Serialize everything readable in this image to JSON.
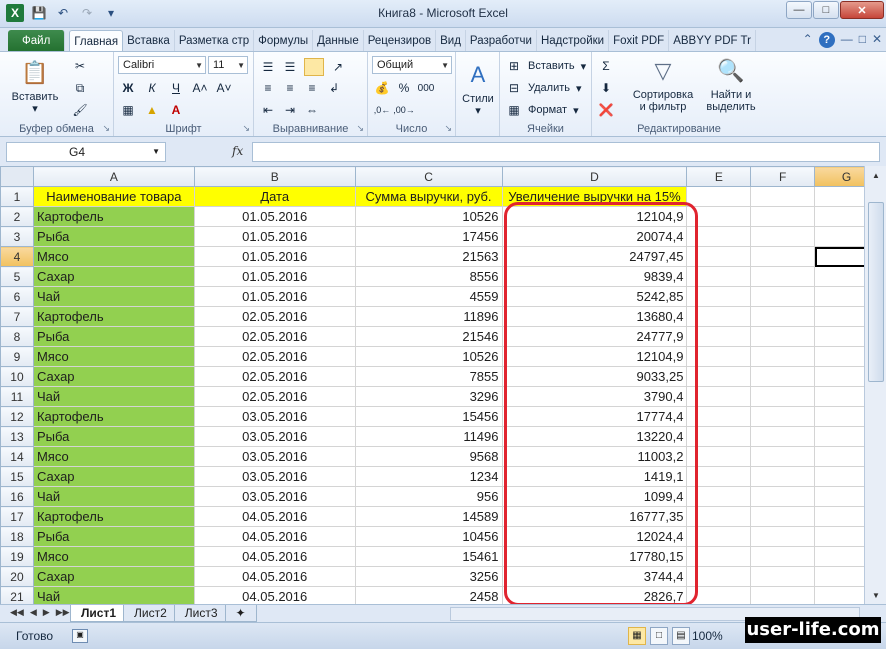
{
  "window": {
    "title": "Книга8 - Microsoft Excel"
  },
  "colors": {
    "header_yellow": "#ffff00",
    "name_green": "#92d050",
    "highlight_red": "#e0242f",
    "excel_green": "#1f7a3c"
  },
  "ribbon": {
    "tabs": [
      "Файл",
      "Главная",
      "Вставка",
      "Разметка стр",
      "Формулы",
      "Данные",
      "Рецензиров",
      "Вид",
      "Разработчи",
      "Надстройки",
      "Foxit PDF",
      "ABBYY PDF Tr"
    ],
    "paste_label": "Вставить",
    "font_name": "Calibri",
    "font_size": "11",
    "number_format": "Общий",
    "styles_label": "Стили",
    "insert_label": "Вставить",
    "delete_label": "Удалить",
    "format_label": "Формат",
    "sort_label_1": "Сортировка",
    "sort_label_2": "и фильтр",
    "find_label_1": "Найти и",
    "find_label_2": "выделить",
    "groups": {
      "clipboard": "Буфер обмена",
      "font": "Шрифт",
      "alignment": "Выравнивание",
      "number": "Число",
      "cells": "Ячейки",
      "editing": "Редактирование"
    }
  },
  "formula_bar": {
    "name_box": "G4",
    "fx_label": "fx",
    "formula": ""
  },
  "sheet": {
    "columns": [
      "A",
      "B",
      "C",
      "D",
      "E",
      "F",
      "G"
    ],
    "headers": [
      "Наименование товара",
      "Дата",
      "Сумма выручки, руб.",
      "Увеличение выручки на 15%"
    ],
    "rows": [
      [
        "Картофель",
        "01.05.2016",
        "10526",
        "12104,9"
      ],
      [
        "Рыба",
        "01.05.2016",
        "17456",
        "20074,4"
      ],
      [
        "Мясо",
        "01.05.2016",
        "21563",
        "24797,45"
      ],
      [
        "Сахар",
        "01.05.2016",
        "8556",
        "9839,4"
      ],
      [
        "Чай",
        "01.05.2016",
        "4559",
        "5242,85"
      ],
      [
        "Картофель",
        "02.05.2016",
        "11896",
        "13680,4"
      ],
      [
        "Рыба",
        "02.05.2016",
        "21546",
        "24777,9"
      ],
      [
        "Мясо",
        "02.05.2016",
        "10526",
        "12104,9"
      ],
      [
        "Сахар",
        "02.05.2016",
        "7855",
        "9033,25"
      ],
      [
        "Чай",
        "02.05.2016",
        "3296",
        "3790,4"
      ],
      [
        "Картофель",
        "03.05.2016",
        "15456",
        "17774,4"
      ],
      [
        "Рыба",
        "03.05.2016",
        "11496",
        "13220,4"
      ],
      [
        "Мясо",
        "03.05.2016",
        "9568",
        "11003,2"
      ],
      [
        "Сахар",
        "03.05.2016",
        "1234",
        "1419,1"
      ],
      [
        "Чай",
        "03.05.2016",
        "956",
        "1099,4"
      ],
      [
        "Картофель",
        "04.05.2016",
        "14589",
        "16777,35"
      ],
      [
        "Рыба",
        "04.05.2016",
        "10456",
        "12024,4"
      ],
      [
        "Мясо",
        "04.05.2016",
        "15461",
        "17780,15"
      ],
      [
        "Сахар",
        "04.05.2016",
        "3256",
        "3744,4"
      ],
      [
        "Чай",
        "04.05.2016",
        "2458",
        "2826,7"
      ]
    ]
  },
  "sheet_tabs": [
    "Лист1",
    "Лист2",
    "Лист3"
  ],
  "status": {
    "ready": "Готово",
    "zoom": "100%"
  },
  "watermark": "user-life.com"
}
